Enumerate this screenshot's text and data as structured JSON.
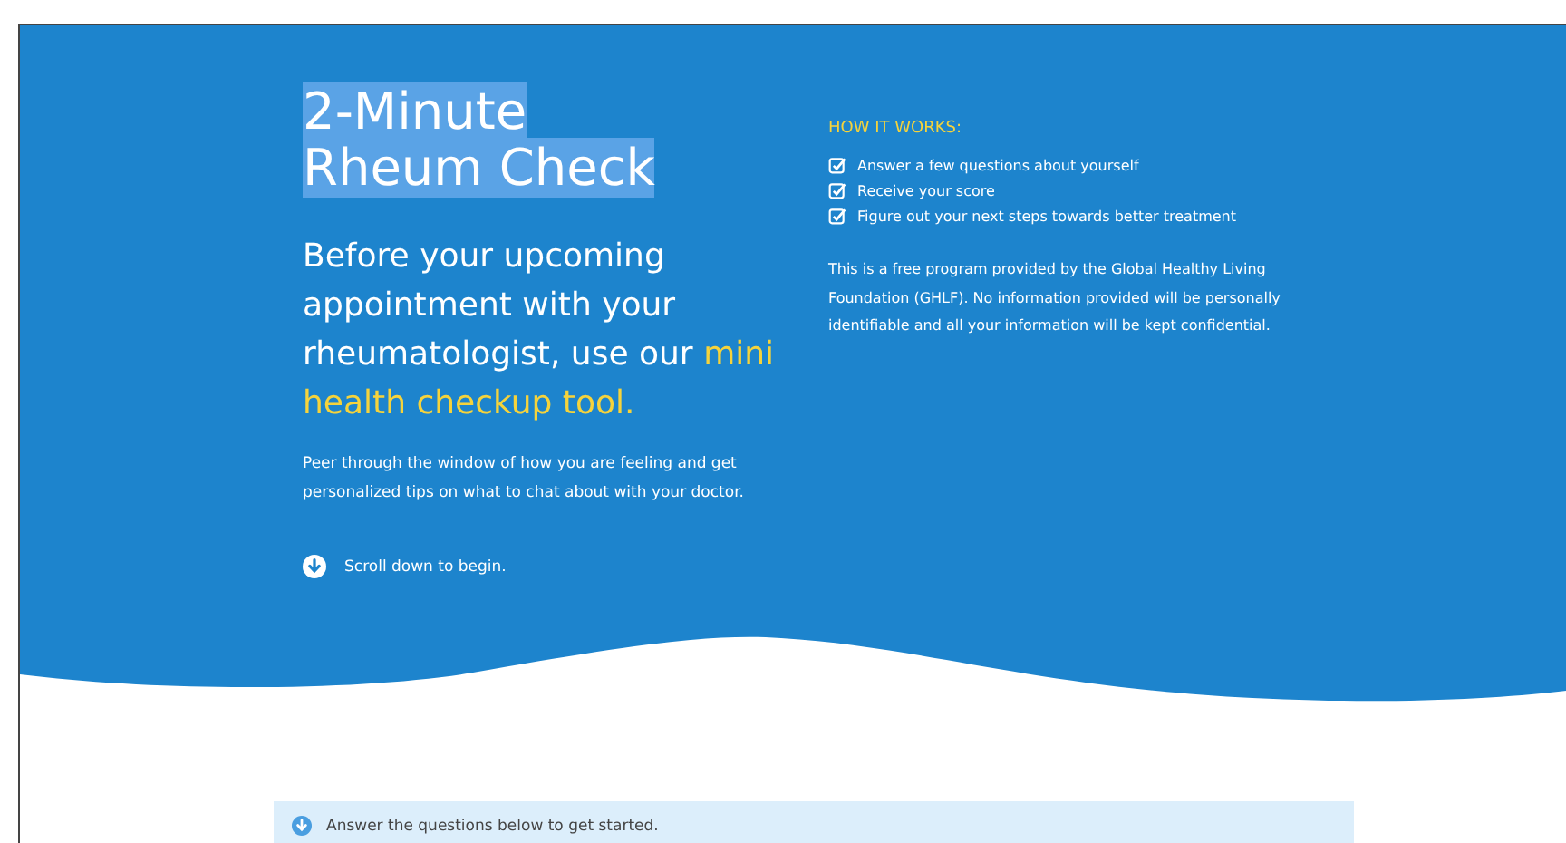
{
  "hero": {
    "title": {
      "text": "2-Minute Rheum Check",
      "selected": true
    },
    "subtitle": "Before your upcoming appointment with your rheumatologist, use our **mini health checkup tool.**",
    "description": "Peer through the window of how you are feeling and get personalized tips on what to chat about with your doctor.",
    "scroll_hint": "Scroll down to begin.",
    "how_it_works": {
      "heading": "HOW IT WORKS:",
      "steps": [
        {
          "text": "Answer a few questions about yourself",
          "checked": true
        },
        {
          "text": "Receive your score",
          "checked": true
        },
        {
          "text": "Figure out your next steps towards better treatment",
          "checked": true
        }
      ],
      "disclaimer": "This is a free program provided by the Global Healthy Living Foundation (GHLF). No information provided will be personally identifiable and all your information will be kept confidential."
    }
  },
  "notice": {
    "text": "Answer the questions below to get started."
  }
}
